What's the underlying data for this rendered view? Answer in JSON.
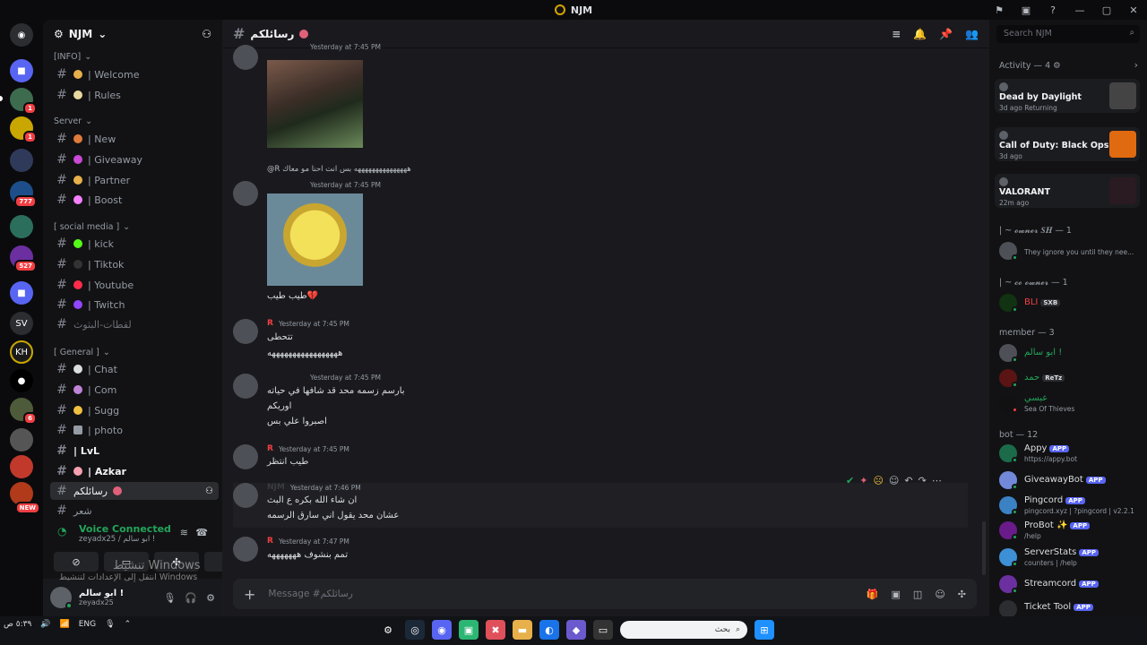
{
  "window": {
    "title": "NJM",
    "controls": [
      "⚑",
      "▣",
      "?",
      "—",
      "▢",
      "✕"
    ]
  },
  "server": {
    "name": "NJM"
  },
  "guild_badges": [
    "1",
    "1",
    "777",
    "527",
    "6"
  ],
  "guild_new": "NEW",
  "categories": {
    "info": "[INFO]",
    "server": "Server",
    "social": "[ social media ]",
    "general": "[ General ]"
  },
  "channels": {
    "welcome": "| Welcome",
    "rules": "| Rules",
    "new": "| New",
    "giveaway": "| Giveaway",
    "partner": "| Partner",
    "boost": "| Boost",
    "kick": "| kick",
    "tiktok": "| Tiktok",
    "youtube": "| Youtube",
    "twitch": "| Twitch",
    "live": "لقطات-البثوث",
    "chat": "| Chat",
    "com": "| Com",
    "sugg": "| Sugg",
    "photo": "| photo",
    "lvl": "| LvL",
    "azkar": "| Azkar",
    "current": "رسائلكم",
    "poetry": "شعر"
  },
  "voice": {
    "status": "Voice Connected",
    "sub": "zeyadx25 / ابو سالم !"
  },
  "user": {
    "name": "ابو سالم !",
    "tag": "zeyadx25"
  },
  "chat": {
    "channel_name": "رسائلكم",
    "messages": [
      {
        "time": "Yesterday at 7:45 PM"
      },
      {
        "reply": "@R هههههههههههههههه بس انت احنا مو معاك",
        "time": "Yesterday at 7:45 PM",
        "caption": "طيب طيب💔"
      },
      {
        "author": "R",
        "time": "Yesterday at 7:45 PM",
        "lines": [
          "تتحطى",
          "هههههههههههههههههه"
        ]
      },
      {
        "time": "Yesterday at 7:45 PM",
        "lines": [
          "بارسم زسمه محد قد شافها في حياته",
          "اوريكم",
          "اصبروا علي بس"
        ]
      },
      {
        "author": "R",
        "time": "Yesterday at 7:45 PM",
        "lines": [
          "طيب انتظر"
        ]
      },
      {
        "author": "NJM",
        "time": "Yesterday at 7:46 PM",
        "lines": [
          "ان شاء الله بكره ع البث",
          "عشان محد يقول اني سارق الرسمه"
        ]
      },
      {
        "author": "R",
        "time": "Yesterday at 7:47 PM",
        "lines": [
          "تمم بنشوف هههههههه"
        ]
      }
    ],
    "composer_placeholder": "Message #رسائلكم"
  },
  "members": {
    "search_placeholder": "Search NJM",
    "activity_header": "Activity — 4",
    "activities": [
      {
        "game": "Dead by Daylight",
        "sub": "3d ago   Returning"
      },
      {
        "game": "Call of Duty: Black Ops III",
        "sub": "3d ago"
      },
      {
        "game": "VALORANT",
        "sub": "22m ago"
      }
    ],
    "owner_header": "| ~ 𝓸𝔀𝓷𝓮𝓻 𝑺𝑯 — 1",
    "owner_status": "They ignore you until they nee...",
    "coowner_header": "| ~ 𝓬𝓸 𝓸𝔀𝓷𝓮𝓻 — 1",
    "coowner_name": "BLI",
    "coowner_tag": "SXB",
    "member_header": "member — 3",
    "member_list": [
      {
        "name": "ابو سالم !",
        "sub": ""
      },
      {
        "name": "حمد",
        "tag": "ReTz",
        "sub": ""
      },
      {
        "name": "عبسي",
        "sub": "Sea Of Thieves"
      }
    ],
    "bot_header": "bot — 12",
    "bots": [
      {
        "name": "Appy",
        "sub": "https://appy.bot"
      },
      {
        "name": "GiveawayBot",
        "sub": ""
      },
      {
        "name": "Pingcord",
        "sub": "pingcord.xyz | ?pingcord | v2.2.1"
      },
      {
        "name": "ProBot ✨",
        "sub": "/help"
      },
      {
        "name": "ServerStats",
        "sub": "counters | /help"
      },
      {
        "name": "Streamcord",
        "sub": ""
      },
      {
        "name": "Ticket Tool",
        "sub": ""
      }
    ],
    "app_label": "APP"
  },
  "taskbar": {
    "lang": "ENG",
    "search_placeholder": "بحث",
    "clock": "٥:٣٩ ص"
  },
  "watermark": {
    "line1": "تنشيط Windows",
    "line2": "انتقل إلى الإعدادات لتنشيط Windows"
  }
}
